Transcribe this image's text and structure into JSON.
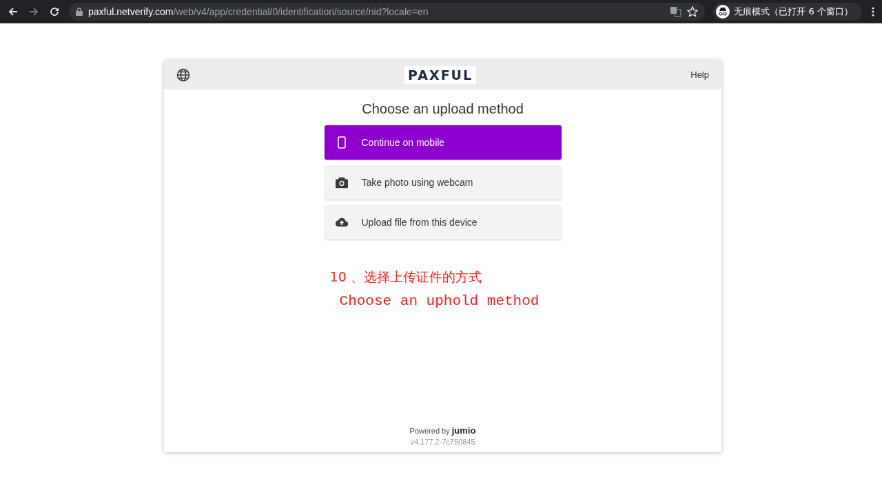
{
  "browser": {
    "url_host": "paxful.netverify.com",
    "url_path": "/web/v4/app/credential/0/identification/source/nid?locale=en",
    "profile": "无痕模式（已打开 6 个窗口）"
  },
  "header": {
    "logo": "PAXFUL",
    "help": "Help"
  },
  "title": "Choose an upload method",
  "options": [
    {
      "label": "Continue on mobile",
      "kind": "mobile",
      "primary": true
    },
    {
      "label": "Take photo using webcam",
      "kind": "camera",
      "primary": false
    },
    {
      "label": "Upload file from this device",
      "kind": "upload",
      "primary": false
    }
  ],
  "annotation": {
    "line_1": "10 、选择上传证件的方式",
    "line_2": "Choose an uphold method"
  },
  "footer": {
    "powered": "Powered by **jumio**",
    "version": "v4.177.2-7c750845"
  }
}
